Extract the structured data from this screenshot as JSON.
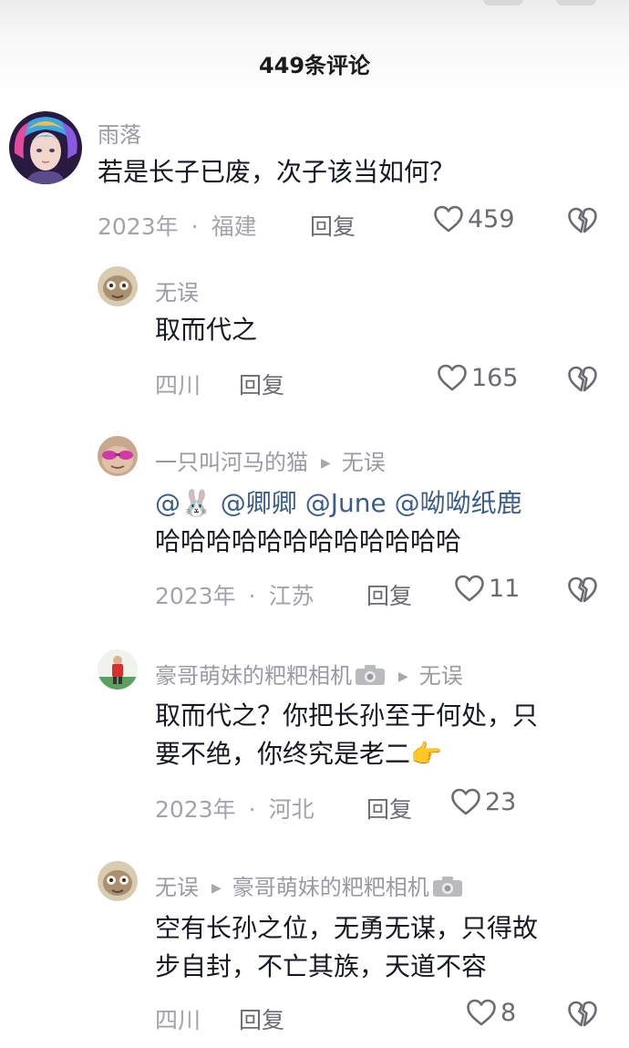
{
  "header": {
    "title": "449条评论"
  },
  "comments": [
    {
      "username": "雨落",
      "text_lines": [
        "若是长子已废，次子该当如何？"
      ],
      "year": "2023年",
      "location": "福建",
      "reply_label": "回复",
      "likes": "459"
    },
    {
      "username": "无误",
      "text_lines": [
        "取而代之"
      ],
      "location": "四川",
      "reply_label": "回复",
      "likes": "165"
    },
    {
      "username": "一只叫河马的猫",
      "reply_to": "无误",
      "mentions": [
        "@🐰",
        "@卿卿",
        "@June",
        "@呦呦纸鹿"
      ],
      "text_lines": [
        "哈哈哈哈哈哈哈哈哈哈哈哈"
      ],
      "year": "2023年",
      "location": "江苏",
      "reply_label": "回复",
      "likes": "11"
    },
    {
      "username": "豪哥萌妹的粑粑相机",
      "reply_to": "无误",
      "text_lines": [
        "取而代之？你把长孙至于何处，只",
        "要不绝，你终究是老二"
      ],
      "emoji": "👉",
      "year": "2023年",
      "location": "河北",
      "reply_label": "回复",
      "likes": "23"
    },
    {
      "username": "无误",
      "reply_to": "豪哥萌妹的粑粑相机",
      "text_lines": [
        "空有长孙之位，无勇无谋，只得故",
        "步自封，不亡其族，天道不容"
      ],
      "location": "四川",
      "reply_label": "回复",
      "likes": "8"
    }
  ],
  "icons": {
    "like": "heart-outline-icon",
    "dislike": "broken-heart-icon",
    "reply_arrow": "triangle-right-icon",
    "camera": "camera-icon"
  },
  "colors": {
    "mention": "#3b5d8a",
    "meta": "#a3a4a9",
    "text": "#161823"
  }
}
